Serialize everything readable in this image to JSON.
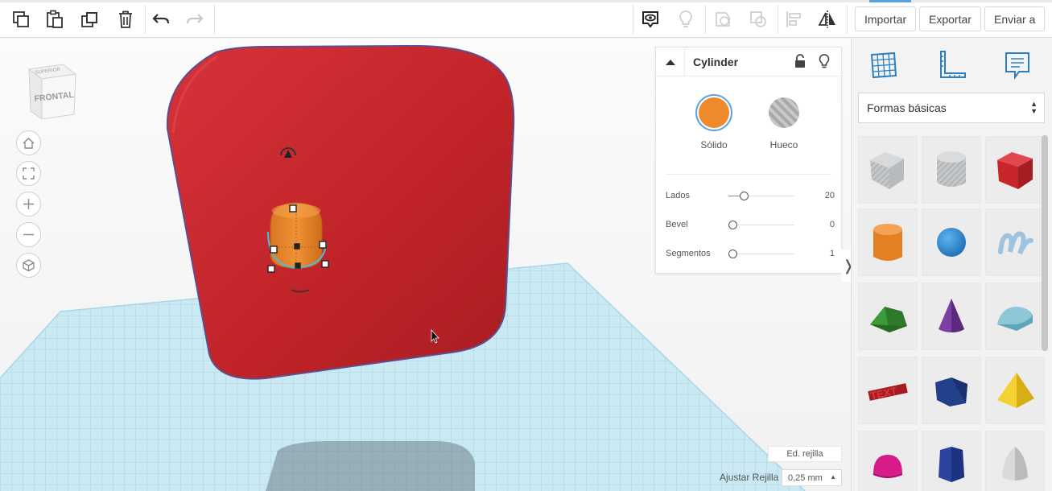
{
  "toolbar": {
    "import_label": "Importar",
    "export_label": "Exportar",
    "send_label": "Enviar a",
    "icons": [
      "copy-icon",
      "paste-icon",
      "duplicate-icon",
      "trash-icon",
      "undo-icon",
      "redo-icon",
      "view-toggle-icon",
      "lightbulb-icon",
      "group-icon",
      "ungroup-icon",
      "align-icon",
      "mirror-icon"
    ]
  },
  "viewcube": {
    "front_label": "FRONTAL",
    "top_label": "SUPERIOR"
  },
  "inspector": {
    "title": "Cylinder",
    "solid_label": "Sólido",
    "hole_label": "Hueco",
    "solid_color": "#ef8a2c",
    "props": [
      {
        "name": "Lados",
        "value": "20",
        "fraction": 0.2
      },
      {
        "name": "Bevel",
        "value": "0",
        "fraction": 0.0
      },
      {
        "name": "Segmentos",
        "value": "1",
        "fraction": 0.0
      }
    ]
  },
  "grid": {
    "edit_label": "Ed. rejilla",
    "snap_label": "Ajustar Rejilla",
    "snap_value": "0,25 mm"
  },
  "library": {
    "selected": "Formas básicas",
    "tabs": [
      "grid-icon",
      "ruler-icon",
      "notes-icon"
    ],
    "shapes": [
      "box-hole",
      "cylinder-hole",
      "box",
      "cylinder",
      "sphere",
      "scribble",
      "roof",
      "cone",
      "round-roof",
      "text",
      "prism",
      "pyramid",
      "half-sphere",
      "polygon",
      "paraboloid"
    ]
  },
  "colors": {
    "box": "#c9262b",
    "cylinder": "#ef8a2c",
    "workplane": "#bfe2ef",
    "accent": "#5aa3e0"
  }
}
